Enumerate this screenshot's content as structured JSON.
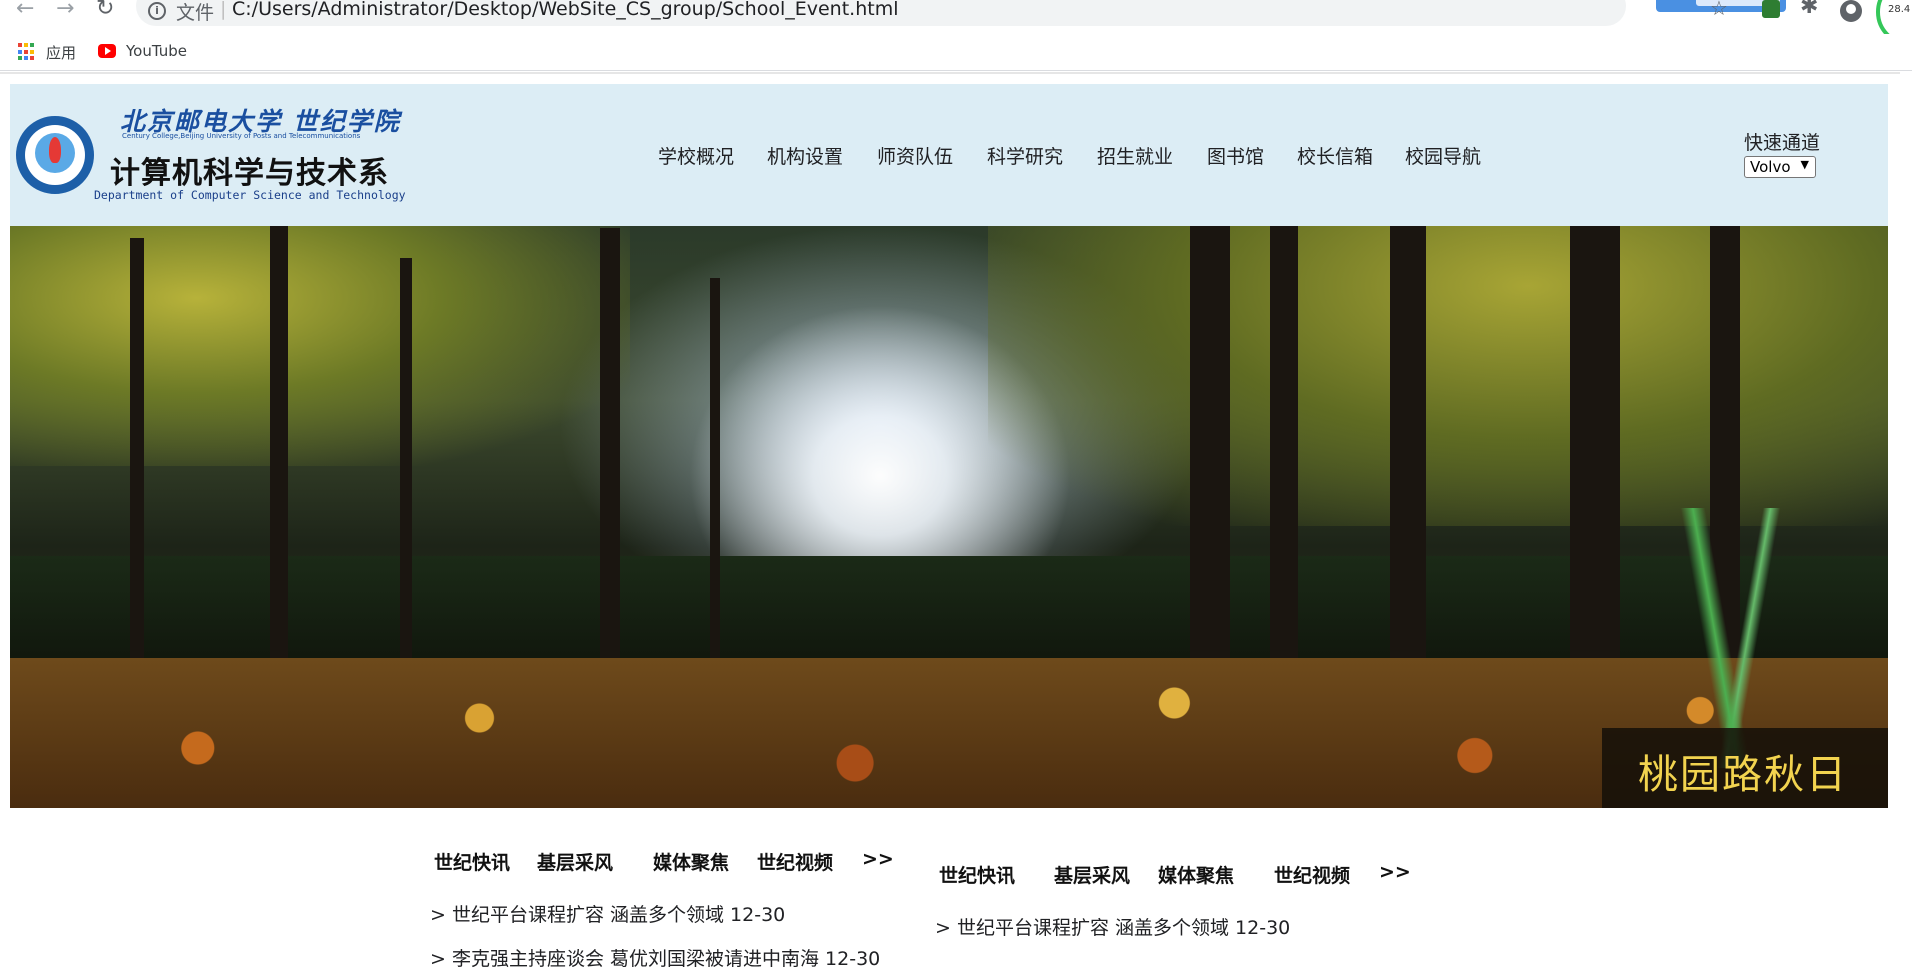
{
  "browser": {
    "url_prefix": "文件",
    "url_separator": "|",
    "url": "C:/Users/Administrator/Desktop/WebSite_CS_group/School_Event.html",
    "perf_value": "28.4",
    "bookmarks": [
      {
        "label": "应用"
      },
      {
        "label": "YouTube"
      }
    ]
  },
  "header": {
    "school_name": "北京邮电大学 世纪学院",
    "school_name_en": "Century College,Beijing University of Posts and Telecommunications",
    "dept_name": "计算机科学与技术系",
    "dept_name_en": "Department of Computer Science and Technology",
    "nav": [
      "学校概况",
      "机构设置",
      "师资队伍",
      "科学研究",
      "招生就业",
      "图书馆",
      "校长信箱",
      "校园导航"
    ],
    "quick_label": "快速通道",
    "quick_select_value": "Volvo"
  },
  "banner": {
    "caption": "桃园路秋日"
  },
  "news": [
    {
      "tabs": [
        "世纪快讯",
        "基层采风",
        "媒体聚焦",
        "世纪视频",
        ">>"
      ],
      "items": [
        "> 世纪平台课程扩容 涵盖多个领域 12-30",
        "> 李克强主持座谈会 葛优刘国梁被请进中南海 12-30"
      ]
    },
    {
      "tabs": [
        "世纪快讯",
        "基层采风",
        "媒体聚焦",
        "世纪视频",
        ">>"
      ],
      "items": [
        "> 世纪平台课程扩容 涵盖多个领域 12-30"
      ]
    }
  ],
  "colors": {
    "header_bg": "#dcedf5",
    "caption_text": "#f2d34f",
    "school_blue": "#1a4fa0"
  }
}
